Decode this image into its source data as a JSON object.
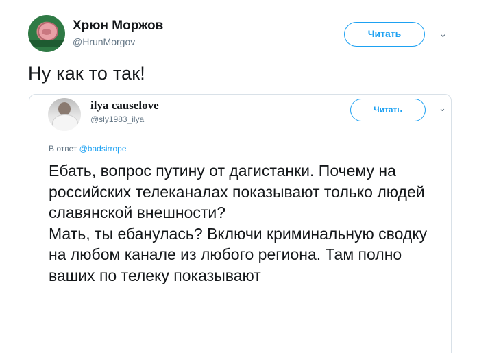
{
  "outer_tweet": {
    "display_name": "Хрюн Моржов",
    "handle": "@HrunMorgov",
    "follow_label": "Читать",
    "text": "Ну как то так!",
    "avatar_caption": "Хрюн Моржов"
  },
  "quoted_tweet": {
    "display_name": "ilya causelove",
    "handle": "@sly1983_ilya",
    "follow_label": "Читать",
    "reply_prefix": "В ответ",
    "reply_mention": "@badsirrope",
    "paragraph_1": "Ебать, вопрос путину от дагистанки. Почему на российских телеканалах показывают только людей славянской внешности?",
    "paragraph_2": "Мать, ты ебанулась? Включи криминальную сводку на любом канале из любого региона. Там полно ваших по телеку показывают"
  },
  "icons": {
    "caret": "chevron-down-icon"
  },
  "colors": {
    "accent": "#1da1f2",
    "secondary_text": "#657786",
    "primary_text": "#14171a",
    "border": "#d9e1e8"
  }
}
